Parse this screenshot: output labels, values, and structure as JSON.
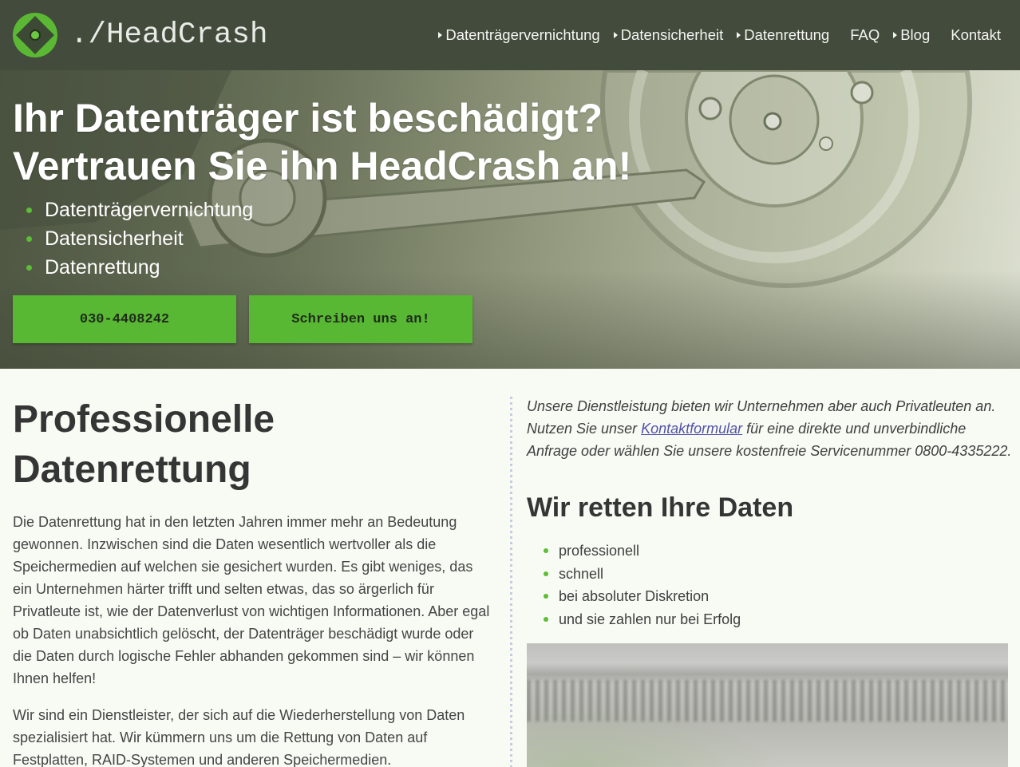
{
  "header": {
    "logo_text": "./HeadCrash",
    "nav": [
      {
        "label": "Datenträgervernichtung",
        "has_submenu": true
      },
      {
        "label": "Datensicherheit",
        "has_submenu": true
      },
      {
        "label": "Datenrettung",
        "has_submenu": true
      },
      {
        "label": "FAQ",
        "has_submenu": false
      },
      {
        "label": "Blog",
        "has_submenu": true
      },
      {
        "label": "Kontakt",
        "has_submenu": false
      }
    ]
  },
  "hero": {
    "title": "Ihr Datenträger ist beschädigt? Vertrauen Sie ihn HeadCrash an!",
    "services": [
      "Datenträgervernichtung",
      "Datensicherheit",
      "Datenrettung"
    ],
    "phone_button": "030-4408242",
    "contact_button": "Schreiben uns an!"
  },
  "main": {
    "left": {
      "heading": "Professionelle Datenrettung",
      "paragraphs": [
        "Die Datenrettung hat in den letzten Jahren immer mehr an Bedeutung gewonnen. Inzwischen sind die Daten wesentlich wertvoller als die Speichermedien auf welchen sie gesichert wurden. Es gibt weniges, das ein Unternehmen härter trifft und selten etwas, das so ärgerlich für Privatleute ist, wie der Datenverlust von wichtigen Informationen. Aber egal ob Daten unabsichtlich gelöscht, der Datenträger beschädigt wurde oder die Daten durch logische Fehler abhanden gekommen sind – wir können Ihnen helfen!",
        "Wir sind ein Dienstleister, der sich auf die Wiederherstellung von Daten spezialisiert hat. Wir kümmern uns um die Rettung von Daten auf Festplatten, RAID-Systemen und anderen Speichermedien."
      ]
    },
    "right": {
      "intro_before_link": "Unsere Dienstleistung bieten wir Unternehmen aber auch Privatleuten an. Nutzen Sie unser ",
      "intro_link": "Kontaktformular",
      "intro_after_link": " für eine direkte und unverbindliche Anfrage oder wählen Sie unsere kostenfreie Servicenummer 0800-4335222.",
      "heading": "Wir retten Ihre Daten",
      "features": [
        "professionell",
        "schnell",
        "bei absoluter Diskretion",
        "und sie zahlen nur bei Erfolg"
      ]
    }
  },
  "colors": {
    "header_bg": "#424b3c",
    "accent": "#58b834",
    "link": "#5151a6",
    "heading_text": "#353535",
    "page_bg": "#f8fbf4"
  },
  "icons": {
    "logo": "logo-icon",
    "submenu": "caret-right-icon",
    "bullet": "bullet-dot-icon"
  }
}
